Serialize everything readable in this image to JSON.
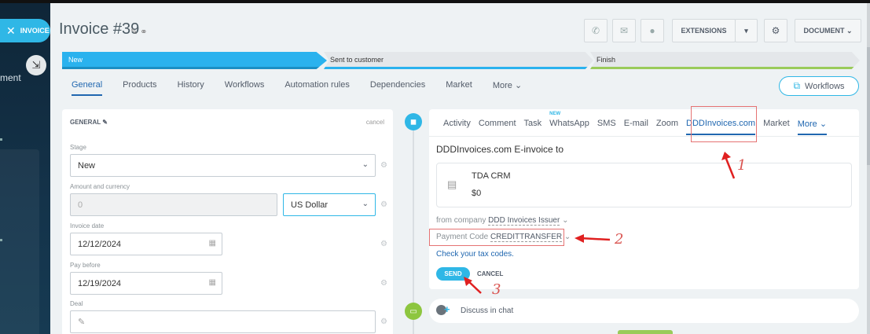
{
  "sidebar": {
    "badge_close": "✕",
    "badge_label": "INVOICE",
    "collapse_icon": "⇲",
    "partial_text": "ment"
  },
  "header": {
    "title": "Invoice #39",
    "title_icons": "✎ ⚭",
    "phone_icon": "✆",
    "mail_icon": "✉",
    "chat_icon": "●",
    "extensions_label": "EXTENSIONS",
    "extensions_caret": "▾",
    "settings_icon": "⚙",
    "document_label": "DOCUMENT ⌄"
  },
  "stages": [
    {
      "label": "New"
    },
    {
      "label": "Sent to customer"
    },
    {
      "label": "Finish"
    }
  ],
  "tabs": [
    {
      "label": "General"
    },
    {
      "label": "Products"
    },
    {
      "label": "History"
    },
    {
      "label": "Workflows"
    },
    {
      "label": "Automation rules"
    },
    {
      "label": "Dependencies"
    },
    {
      "label": "Market"
    },
    {
      "label": "More ⌄"
    }
  ],
  "workflows_button": {
    "icon": "⧉",
    "label": "Workflows"
  },
  "general_card": {
    "heading": "GENERAL ✎",
    "cancel": "cancel",
    "stage_label": "Stage",
    "stage_value": "New",
    "amount_label": "Amount and currency",
    "amount_value": "0",
    "currency_value": "US Dollar",
    "invoice_date_label": "Invoice date",
    "invoice_date_value": "12/12/2024",
    "pay_before_label": "Pay before",
    "pay_before_value": "12/19/2024",
    "deal_label": "Deal",
    "deal_icon": "✎",
    "chevron": "⌄",
    "calendar_icon": "▦",
    "gear_icon": "⚙"
  },
  "timeline": {
    "dot1_icon": "◼",
    "dot2_icon": "▭"
  },
  "activity_card": {
    "tabs": [
      "Activity",
      "Comment",
      "Task",
      "WhatsApp",
      "SMS",
      "E-mail",
      "Zoom",
      "DDDInvoices.com",
      "Market",
      "More ⌄"
    ],
    "new_badge": "NEW",
    "heading": "DDDInvoices.com E-invoice to",
    "client_icon": "▤",
    "client_name": "TDA CRM",
    "client_amount": "$0",
    "from_prefix": "from company",
    "from_value": "DDD Invoices Issuer",
    "from_caret": "⌄",
    "payment_prefix": "Payment Code",
    "payment_value": "CREDITTRANSFER",
    "payment_caret": "⌄",
    "tax_link": "Check your tax codes.",
    "send_label": "SEND",
    "cancel_label": "CANCEL"
  },
  "chat": {
    "label": "Discuss in chat",
    "plus": "+"
  },
  "annotations": [
    "1",
    "2",
    "3"
  ],
  "colors": {
    "accent": "#2fb7e6",
    "link": "#2067b0",
    "annotation": "#d9534f",
    "green": "#8dc63f"
  }
}
